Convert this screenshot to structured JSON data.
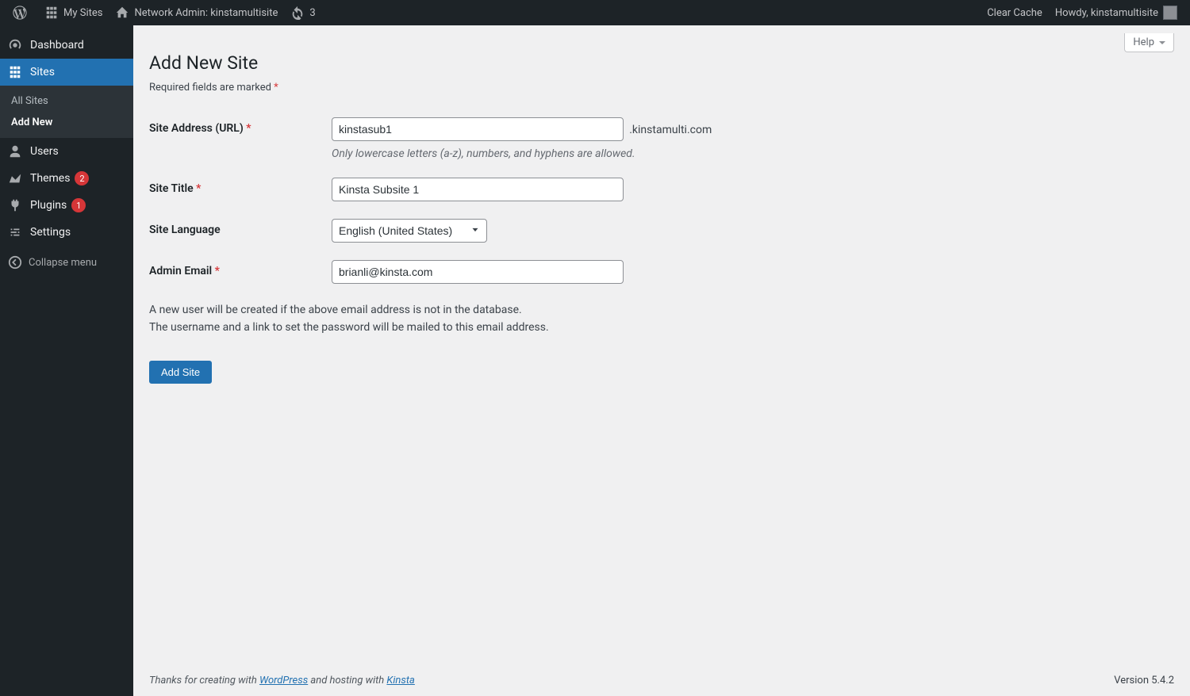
{
  "adminbar": {
    "my_sites": "My Sites",
    "network_admin": "Network Admin: kinstamultisite",
    "comments_count": "3",
    "clear_cache": "Clear Cache",
    "howdy": "Howdy, kinstamultisite"
  },
  "sidebar": {
    "dashboard": "Dashboard",
    "sites": "Sites",
    "sub_all_sites": "All Sites",
    "sub_add_new": "Add New",
    "users": "Users",
    "themes": "Themes",
    "themes_badge": "2",
    "plugins": "Plugins",
    "plugins_badge": "1",
    "settings": "Settings",
    "collapse": "Collapse menu"
  },
  "screen": {
    "help": "Help",
    "title": "Add New Site",
    "required_note": "Required fields are marked ",
    "star": "*"
  },
  "form": {
    "site_address_label": "Site Address (URL) ",
    "site_address_value": "kinstasub1",
    "site_address_suffix": ".kinstamulti.com",
    "site_address_desc": "Only lowercase letters (a-z), numbers, and hyphens are allowed.",
    "site_title_label": "Site Title ",
    "site_title_value": "Kinsta Subsite 1",
    "site_language_label": "Site Language",
    "site_language_value": "English (United States)",
    "admin_email_label": "Admin Email ",
    "admin_email_value": "brianli@kinsta.com",
    "info_line1": "A new user will be created if the above email address is not in the database.",
    "info_line2": "The username and a link to set the password will be mailed to this email address.",
    "submit": "Add Site"
  },
  "footer": {
    "thanks_pre": "Thanks for creating with ",
    "wordpress": "WordPress",
    "thanks_mid": " and hosting with ",
    "kinsta": "Kinsta",
    "version": "Version 5.4.2"
  }
}
